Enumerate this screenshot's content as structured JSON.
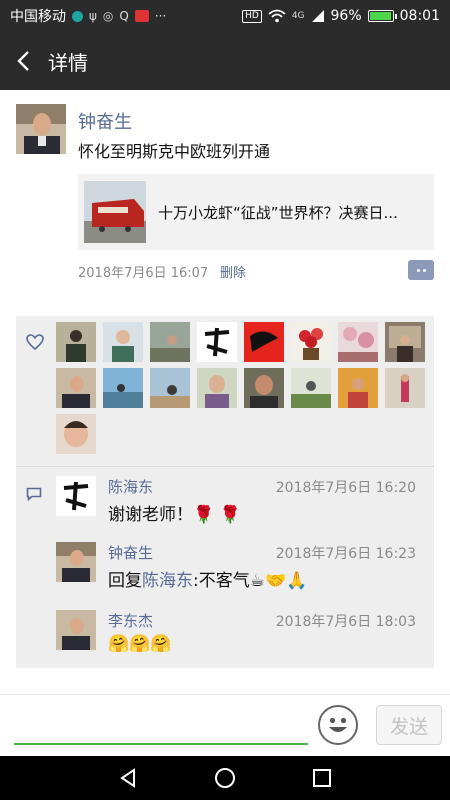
{
  "status_bar": {
    "carrier": "中国移动",
    "network_badge": "HD",
    "signal_label": "4G",
    "battery_text": "96%",
    "battery_level": 0.96,
    "time": "08:01",
    "icons": [
      "app-dot-icon",
      "usb-icon",
      "notification-icon",
      "q-icon",
      "app-red-icon",
      "more-icon",
      "wifi-icon",
      "signal-icon",
      "battery-icon"
    ]
  },
  "header": {
    "title": "详情",
    "back_icon": "chevron-left-icon"
  },
  "post": {
    "author": "钟奋生",
    "text": "怀化至明斯克中欧班列开通",
    "share_title": "十万小龙虾“征战”世界杯？决赛日...",
    "time": "2018年7月6日 16:07",
    "delete_label": "删除",
    "comment_button_icon": "comment-more-icon"
  },
  "likes": {
    "icon": "heart-icon",
    "count": 17
  },
  "comments": [
    {
      "name": "陈海东",
      "time": "2018年7月6日 16:20",
      "text": "谢谢老师！🌹 🌹",
      "reply_prefix": "",
      "reply_to": "",
      "reply_suffix": ""
    },
    {
      "name": "钟奋生",
      "time": "2018年7月6日 16:23",
      "text": "",
      "reply_prefix": "回复",
      "reply_to": "陈海东",
      "reply_suffix": ":不客气☕🤝🙏"
    },
    {
      "name": "李东杰",
      "time": "2018年7月6日 18:03",
      "text": "🤗🤗🤗",
      "reply_prefix": "",
      "reply_to": "",
      "reply_suffix": ""
    }
  ],
  "comment_icon": "comment-bubble-icon",
  "input": {
    "placeholder": "",
    "emoji_icon": "smiley-icon",
    "send_label": "发送"
  },
  "nav": {
    "back": "triangle-back-icon",
    "home": "circle-home-icon",
    "recents": "square-recents-icon"
  },
  "colors": {
    "bar": "#2b2b2b",
    "link": "#576b95",
    "accent_green": "#4bb849",
    "interaction_bg": "#eeeeee"
  }
}
